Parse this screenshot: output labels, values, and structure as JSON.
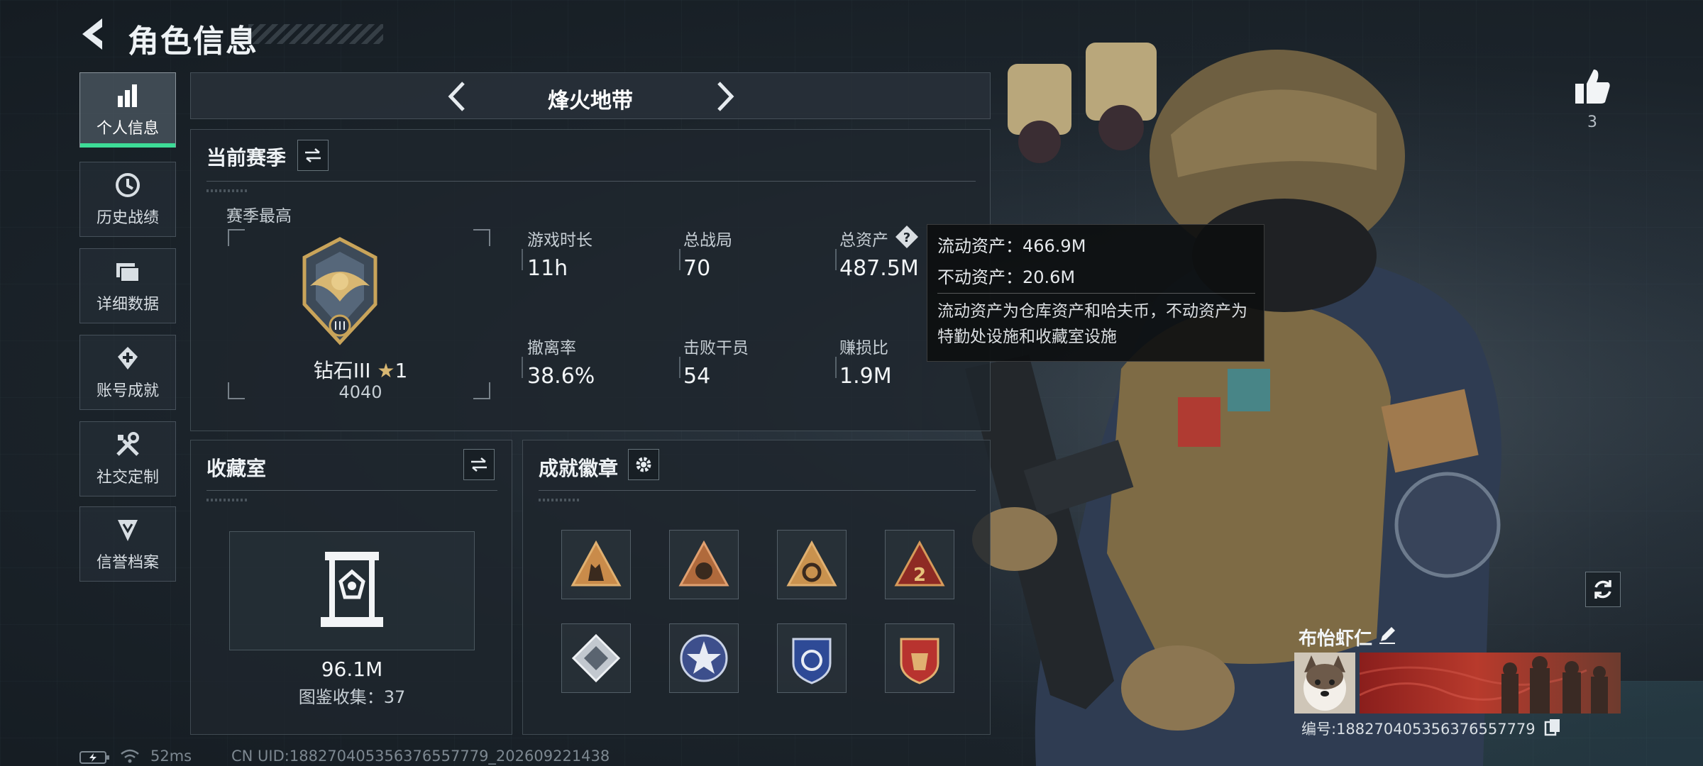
{
  "header": {
    "title": "角色信息"
  },
  "sidebar": {
    "items": [
      {
        "label": "个人信息",
        "icon": "bar-chart-icon"
      },
      {
        "label": "历史战绩",
        "icon": "clock-history-icon"
      },
      {
        "label": "详细数据",
        "icon": "folder-icon"
      },
      {
        "label": "账号成就",
        "icon": "badge-cross-icon"
      },
      {
        "label": "社交定制",
        "icon": "tools-icon"
      },
      {
        "label": "信誉档案",
        "icon": "shield-crest-icon"
      }
    ],
    "active_index": 0
  },
  "mode_selector": {
    "current": "烽火地带"
  },
  "season": {
    "title": "当前赛季",
    "best_label": "赛季最高",
    "rank": {
      "name": "钻石III",
      "stars": "1",
      "score": "4040"
    },
    "stats": [
      {
        "label": "游戏时长",
        "value": "11h"
      },
      {
        "label": "总战局",
        "value": "70"
      },
      {
        "label": "总资产",
        "value": "487.5M"
      },
      {
        "label": "撤离率",
        "value": "38.6%"
      },
      {
        "label": "击败干员",
        "value": "54"
      },
      {
        "label": "赚损比",
        "value": "1.9M"
      }
    ]
  },
  "tooltip": {
    "liquid": "流动资产：466.9M",
    "fixed": "不动资产：20.6M",
    "description": "流动资产为仓库资产和哈夫币，不动资产为特勤处设施和收藏室设施"
  },
  "collection": {
    "title": "收藏室",
    "value": "96.1M",
    "count_text": "图鉴收集：37"
  },
  "achievements": {
    "title": "成就徽章",
    "badges": [
      "triangle-badge-soldiers-icon",
      "triangle-badge-fist-icon",
      "triangle-badge-gear-icon",
      "triangle-badge-number-icon",
      "diamond-badge-icon",
      "star-wheel-badge-icon",
      "blue-shield-badge-icon",
      "red-shield-badge-icon"
    ]
  },
  "likes": {
    "count": "3"
  },
  "player": {
    "name": "布怡虾仁",
    "id_text": "编号:1882704053563765577​79"
  },
  "footer": {
    "ping": "52ms",
    "uid": "CN UID:1882704053563765577​79_202609221438"
  },
  "colors": {
    "accent_green": "#3ddc97",
    "gold": "#c9a45a"
  }
}
